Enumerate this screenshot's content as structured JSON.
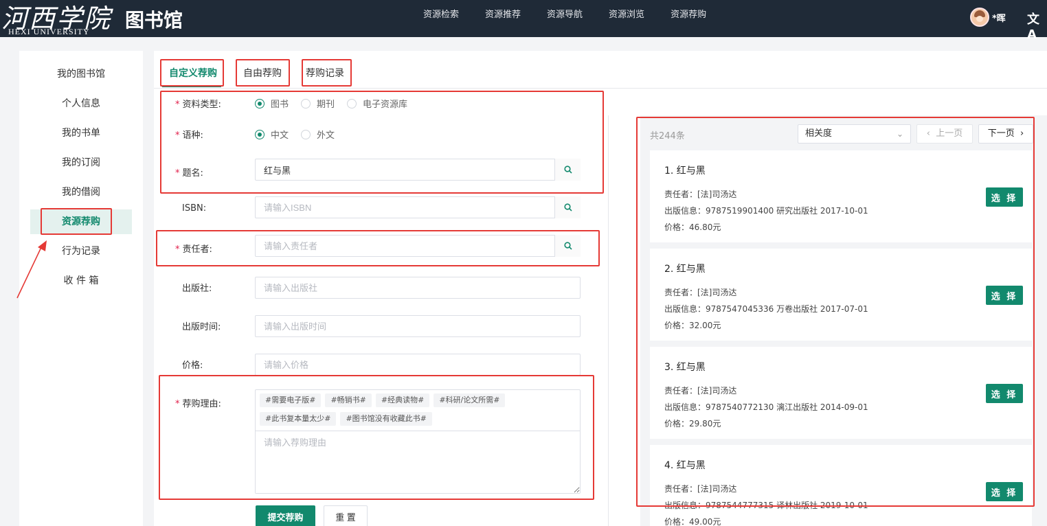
{
  "header": {
    "logo_cn": "河西学院",
    "logo_en": "HEXI UNIVERSITY",
    "library_title": "图书馆",
    "nav": [
      "资源检索",
      "资源推荐",
      "资源导航",
      "资源浏览",
      "资源荐购"
    ],
    "user_name": "*晖",
    "lang_icon": "文A"
  },
  "sidebar": {
    "items": [
      {
        "label": "我的图书馆"
      },
      {
        "label": "个人信息"
      },
      {
        "label": "我的书单"
      },
      {
        "label": "我的订阅"
      },
      {
        "label": "我的借阅"
      },
      {
        "label": "资源荐购"
      },
      {
        "label": "行为记录"
      },
      {
        "label": "收 件 箱"
      }
    ],
    "active_index": 5
  },
  "tabs": [
    "自定义荐购",
    "自由荐购",
    "荐购记录"
  ],
  "form": {
    "material_type": {
      "label": "资料类型:",
      "options": [
        "图书",
        "期刊",
        "电子资源库"
      ],
      "selected": "图书"
    },
    "language": {
      "label": "语种:",
      "options": [
        "中文",
        "外文"
      ],
      "selected": "中文"
    },
    "title": {
      "label": "题名:",
      "value": "红与黑"
    },
    "isbn": {
      "label": "ISBN:",
      "placeholder": "请输入ISBN"
    },
    "author": {
      "label": "责任者:",
      "placeholder": "请输入责任者"
    },
    "publisher": {
      "label": "出版社:",
      "placeholder": "请输入出版社"
    },
    "pub_date": {
      "label": "出版时间:",
      "placeholder": "请输入出版时间"
    },
    "price": {
      "label": "价格:",
      "placeholder": "请输入价格"
    },
    "reason": {
      "label": "荐购理由:",
      "tags": [
        "#需要电子版#",
        "#畅销书#",
        "#经典读物#",
        "#科研/论文所需#",
        "#此书复本量太少#",
        "#图书馆没有收藏此书#"
      ],
      "placeholder": "请输入荐购理由"
    },
    "submit_label": "提交荐购",
    "reset_label": "重 置"
  },
  "results": {
    "count_text": "共244条",
    "sort_selected": "相关度",
    "prev_label": "上一页",
    "next_label": "下一页",
    "choose_label": "选 择",
    "items": [
      {
        "title": "1. 红与黑",
        "author": "责任者：[法]司汤达",
        "pub": "出版信息：9787519901400  研究出版社  2017-10-01",
        "price": "价格：46.80元"
      },
      {
        "title": "2. 红与黑",
        "author": "责任者：[法]司汤达",
        "pub": "出版信息：9787547045336  万卷出版社  2017-07-01",
        "price": "价格：32.00元"
      },
      {
        "title": "3. 红与黑",
        "author": "责任者：[法]司汤达",
        "pub": "出版信息：9787540772130  漓江出版社  2014-09-01",
        "price": "价格：29.80元"
      },
      {
        "title": "4. 红与黑",
        "author": "责任者：[法]司汤达",
        "pub": "出版信息：9787544777315  译林出版社  2019-10-01",
        "price": "价格：49.00元"
      }
    ]
  },
  "colors": {
    "accent": "#12896d",
    "annotation": "#e53935",
    "topbar": "#1f2a37"
  }
}
